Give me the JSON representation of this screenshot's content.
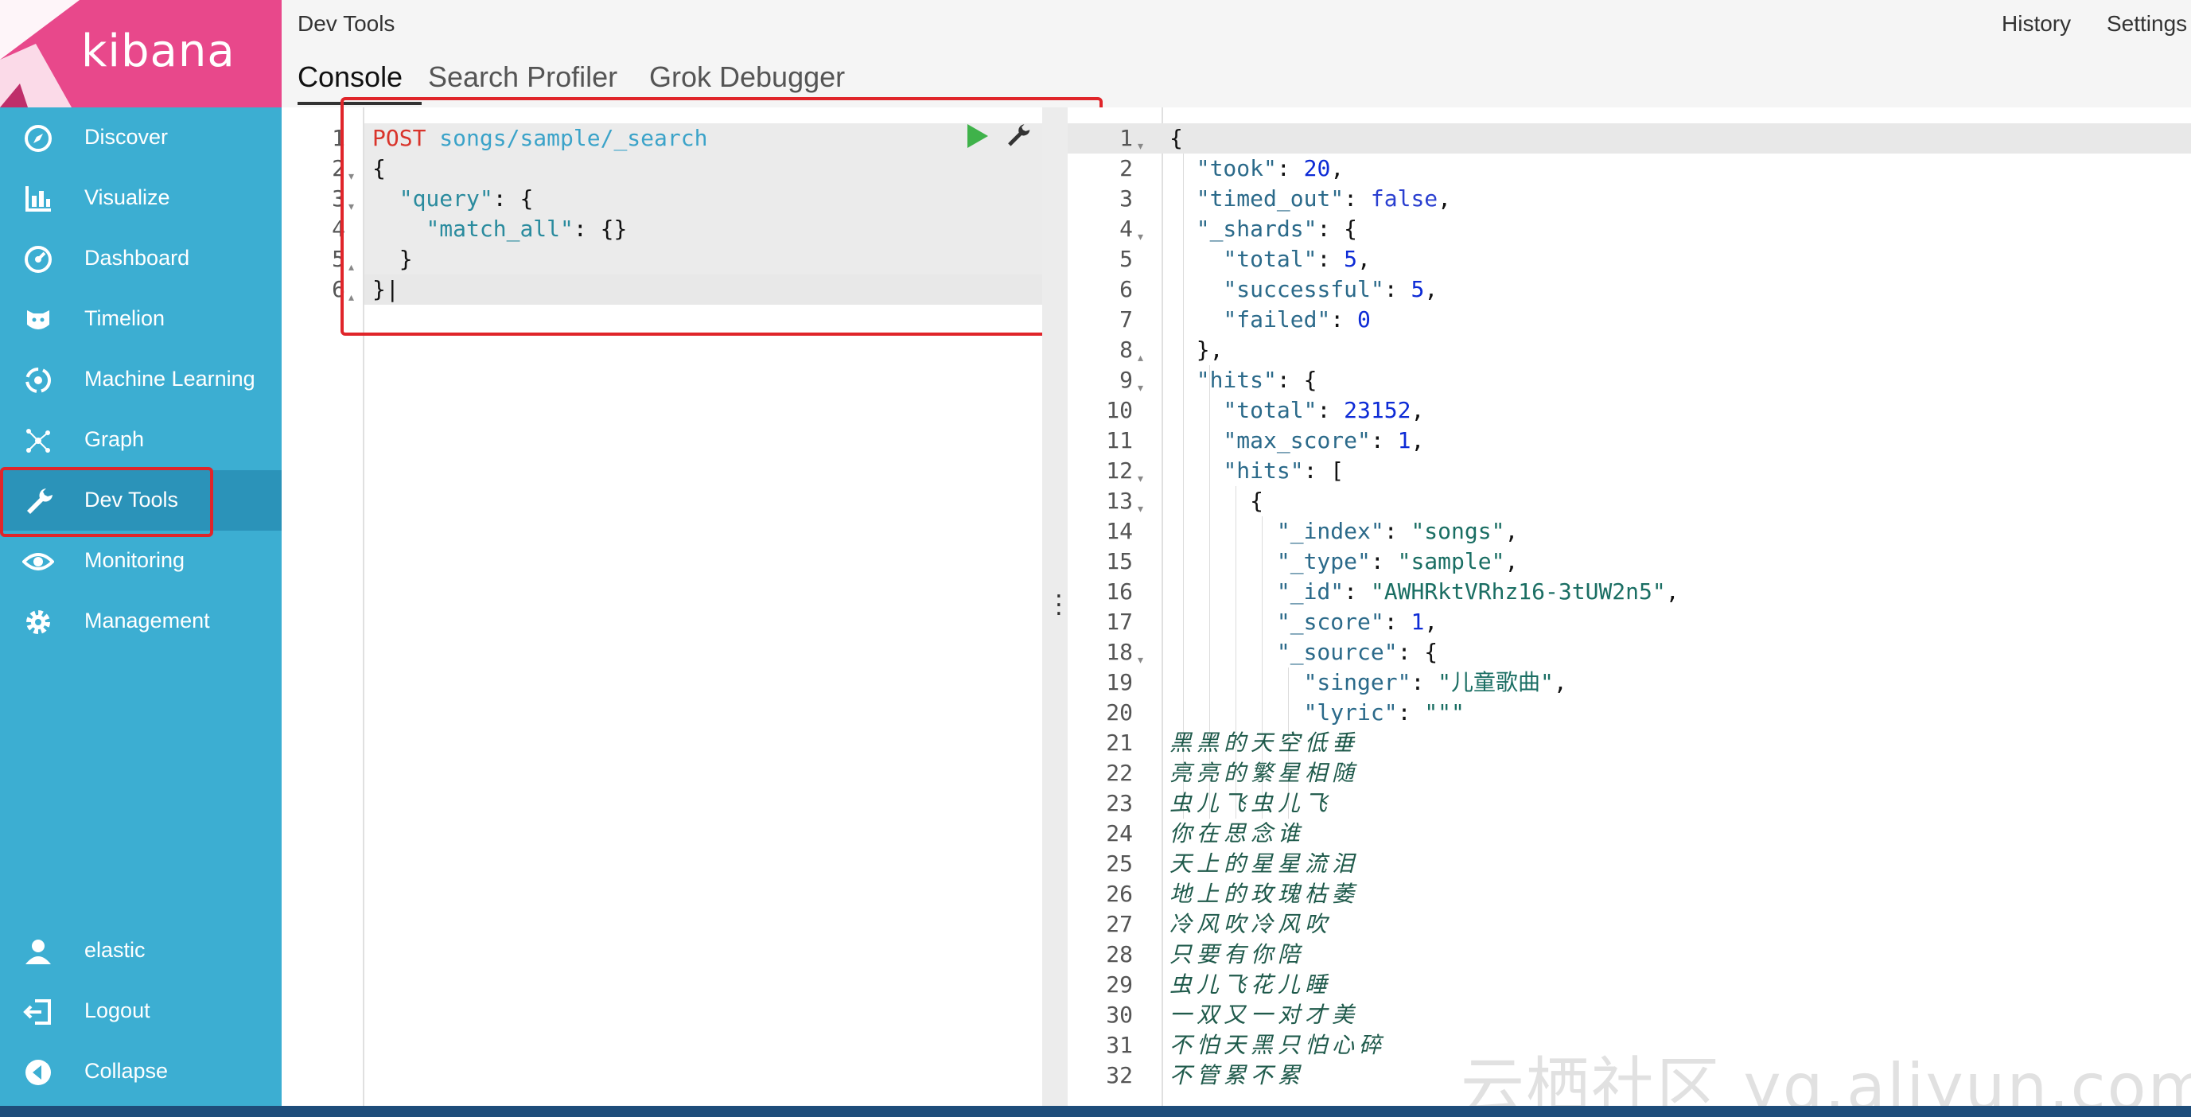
{
  "app": {
    "logo_text": "kibana",
    "title": "Dev Tools"
  },
  "header": {
    "history": "History",
    "settings": "Settings"
  },
  "tabs": [
    "Console",
    "Search Profiler",
    "Grok Debugger"
  ],
  "sidebar": {
    "items": [
      "Discover",
      "Visualize",
      "Dashboard",
      "Timelion",
      "Machine Learning",
      "Graph",
      "Dev Tools",
      "Monitoring",
      "Management"
    ],
    "bottom": [
      "elastic",
      "Logout",
      "Collapse"
    ],
    "active": "Dev Tools"
  },
  "request": {
    "method": "POST",
    "path": "songs/sample/_search",
    "line_numbers": [
      "1",
      "2",
      "3",
      "4",
      "5",
      "6"
    ]
  },
  "response": {
    "line_numbers": [
      "1",
      "2",
      "3",
      "4",
      "5",
      "6",
      "7",
      "8",
      "9",
      "10",
      "11",
      "12",
      "13",
      "14",
      "15",
      "16",
      "17",
      "18",
      "19",
      "20",
      "21",
      "22",
      "23",
      "24",
      "25",
      "26",
      "27",
      "28",
      "29",
      "30",
      "31",
      "32"
    ],
    "took": "20",
    "timed_out": "false",
    "shards_total": "5",
    "shards_successful": "5",
    "shards_failed": "0",
    "hits_total": "23152",
    "max_score": "1",
    "index": "\"songs\"",
    "type": "\"sample\"",
    "id": "\"AWHRktVRhz16-3tUW2n5\"",
    "score": "1",
    "singer": "\"儿童歌曲\"",
    "lyric_open": "\"\"\"",
    "lyrics": [
      "黑黑的天空低垂",
      "亮亮的繁星相随",
      "虫儿飞虫儿飞",
      "你在思念谁",
      "天上的星星流泪",
      "地上的玫瑰枯萎",
      "冷风吹冷风吹",
      "只要有你陪",
      "虫儿飞花儿睡",
      "一双又一对才美",
      "不怕天黑只怕心碎",
      "不管累不累"
    ]
  },
  "watermark": "云栖社区 yq.aliyun.com",
  "colors": {
    "sidebar": "#3caed2",
    "logo_bg": "#e8488b",
    "highlight": "#e0252a",
    "active_item": "#2b93b9"
  }
}
